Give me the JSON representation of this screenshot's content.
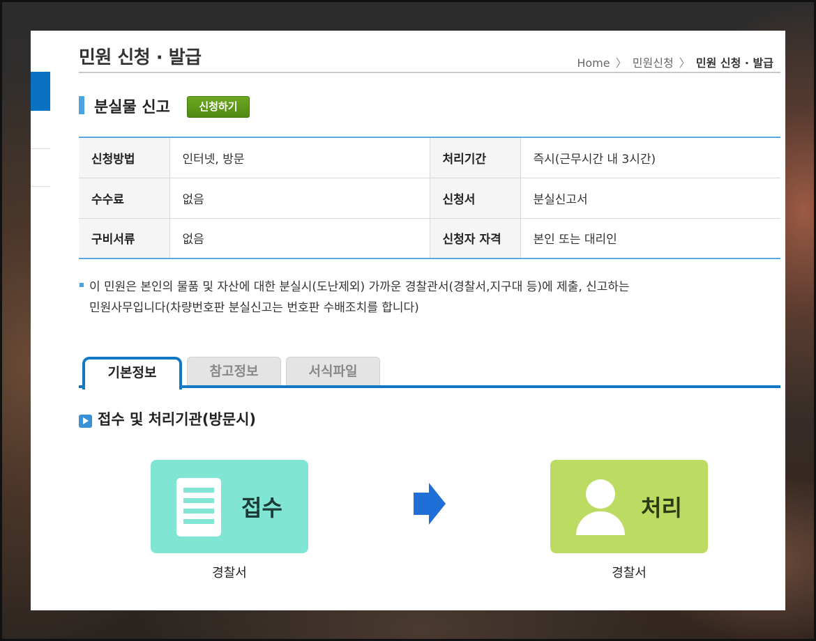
{
  "header": {
    "page_title": "민원 신청 · 발급",
    "breadcrumb": {
      "home": "Home",
      "sep": "〉",
      "level1": "민원신청",
      "current": "민원 신청 · 발급"
    }
  },
  "section": {
    "title": "분실물 신고",
    "apply_button": "신청하기"
  },
  "info_table": {
    "rows": [
      [
        {
          "label": "신청방법",
          "value": "인터넷, 방문"
        },
        {
          "label": "처리기간",
          "value": "즉시(근무시간 내 3시간)"
        }
      ],
      [
        {
          "label": "수수료",
          "value": "없음"
        },
        {
          "label": "신청서",
          "value": "분실신고서"
        }
      ],
      [
        {
          "label": "구비서류",
          "value": "없음"
        },
        {
          "label": "신청자 자격",
          "value": "본인 또는 대리인"
        }
      ]
    ]
  },
  "notice": {
    "line1": "이 민원은 본인의 물품 및 자산에 대한 분실시(도난제외) 가까운 경찰관서(경찰서,지구대 등)에 제출, 신고하는",
    "line2": "민원사무입니다(차량번호판 분실신고는 번호판 수배조치를 합니다)"
  },
  "tabs": [
    {
      "label": "기본정보",
      "active": true
    },
    {
      "label": "참고정보",
      "active": false
    },
    {
      "label": "서식파일",
      "active": false
    }
  ],
  "flow": {
    "title": "접수 및 처리기관(방문시)",
    "steps": [
      {
        "label": "접수",
        "caption": "경찰서",
        "icon": "document-icon",
        "color": "#80e6d3"
      },
      {
        "label": "처리",
        "caption": "경찰서",
        "icon": "person-icon",
        "color": "#bcdb62"
      }
    ],
    "arrow_icon": "right-arrow-icon",
    "arrow_color": "#1f6fd6"
  },
  "colors": {
    "accent_blue": "#1178c4",
    "table_border": "#5aa7e0",
    "apply_green": "#5a9618"
  }
}
